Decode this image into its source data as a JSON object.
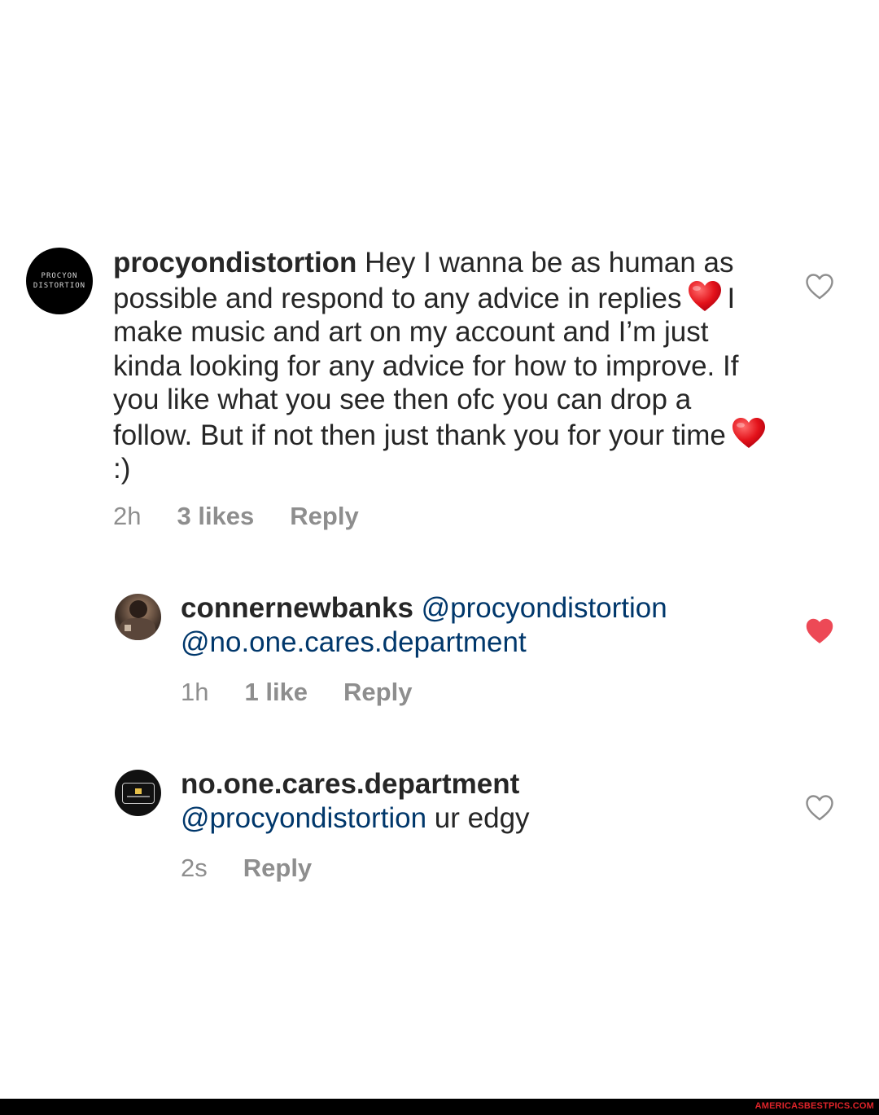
{
  "comments": [
    {
      "avatar": {
        "line1": "PROCYON",
        "line2": "DISTORTION"
      },
      "username": "procyondistortion",
      "text_parts": [
        " Hey I wanna be as human as possible and respond to any advice in replies",
        "I make music and art on my account and I’m just kinda looking for any advice for how to improve. If you like what you see then ofc you can drop a follow. But if not then just thank you for your time",
        ":)"
      ],
      "time": "2h",
      "likes": "3 likes",
      "reply": "Reply",
      "liked": false
    },
    {
      "username": "connernewbanks",
      "mention1": "@procyondistortion",
      "mention2": "@no.one.cares.department",
      "time": "1h",
      "likes": "1 like",
      "reply": "Reply",
      "liked": true
    },
    {
      "username": "no.one.cares.department",
      "mention": "@procyondistortion",
      "text": " ur edgy",
      "time": "2s",
      "reply": "Reply",
      "liked": false
    }
  ],
  "icons": {
    "heart_emoji": "red-heart-emoji",
    "like_outline": "heart-outline-icon",
    "like_filled": "heart-filled-icon"
  },
  "colors": {
    "text": "#262626",
    "mention": "#00376b",
    "meta": "#8e8e8e",
    "liked_heart": "#ed4956"
  },
  "footer": {
    "credit": "AMERICASBESTPICS.COM"
  }
}
